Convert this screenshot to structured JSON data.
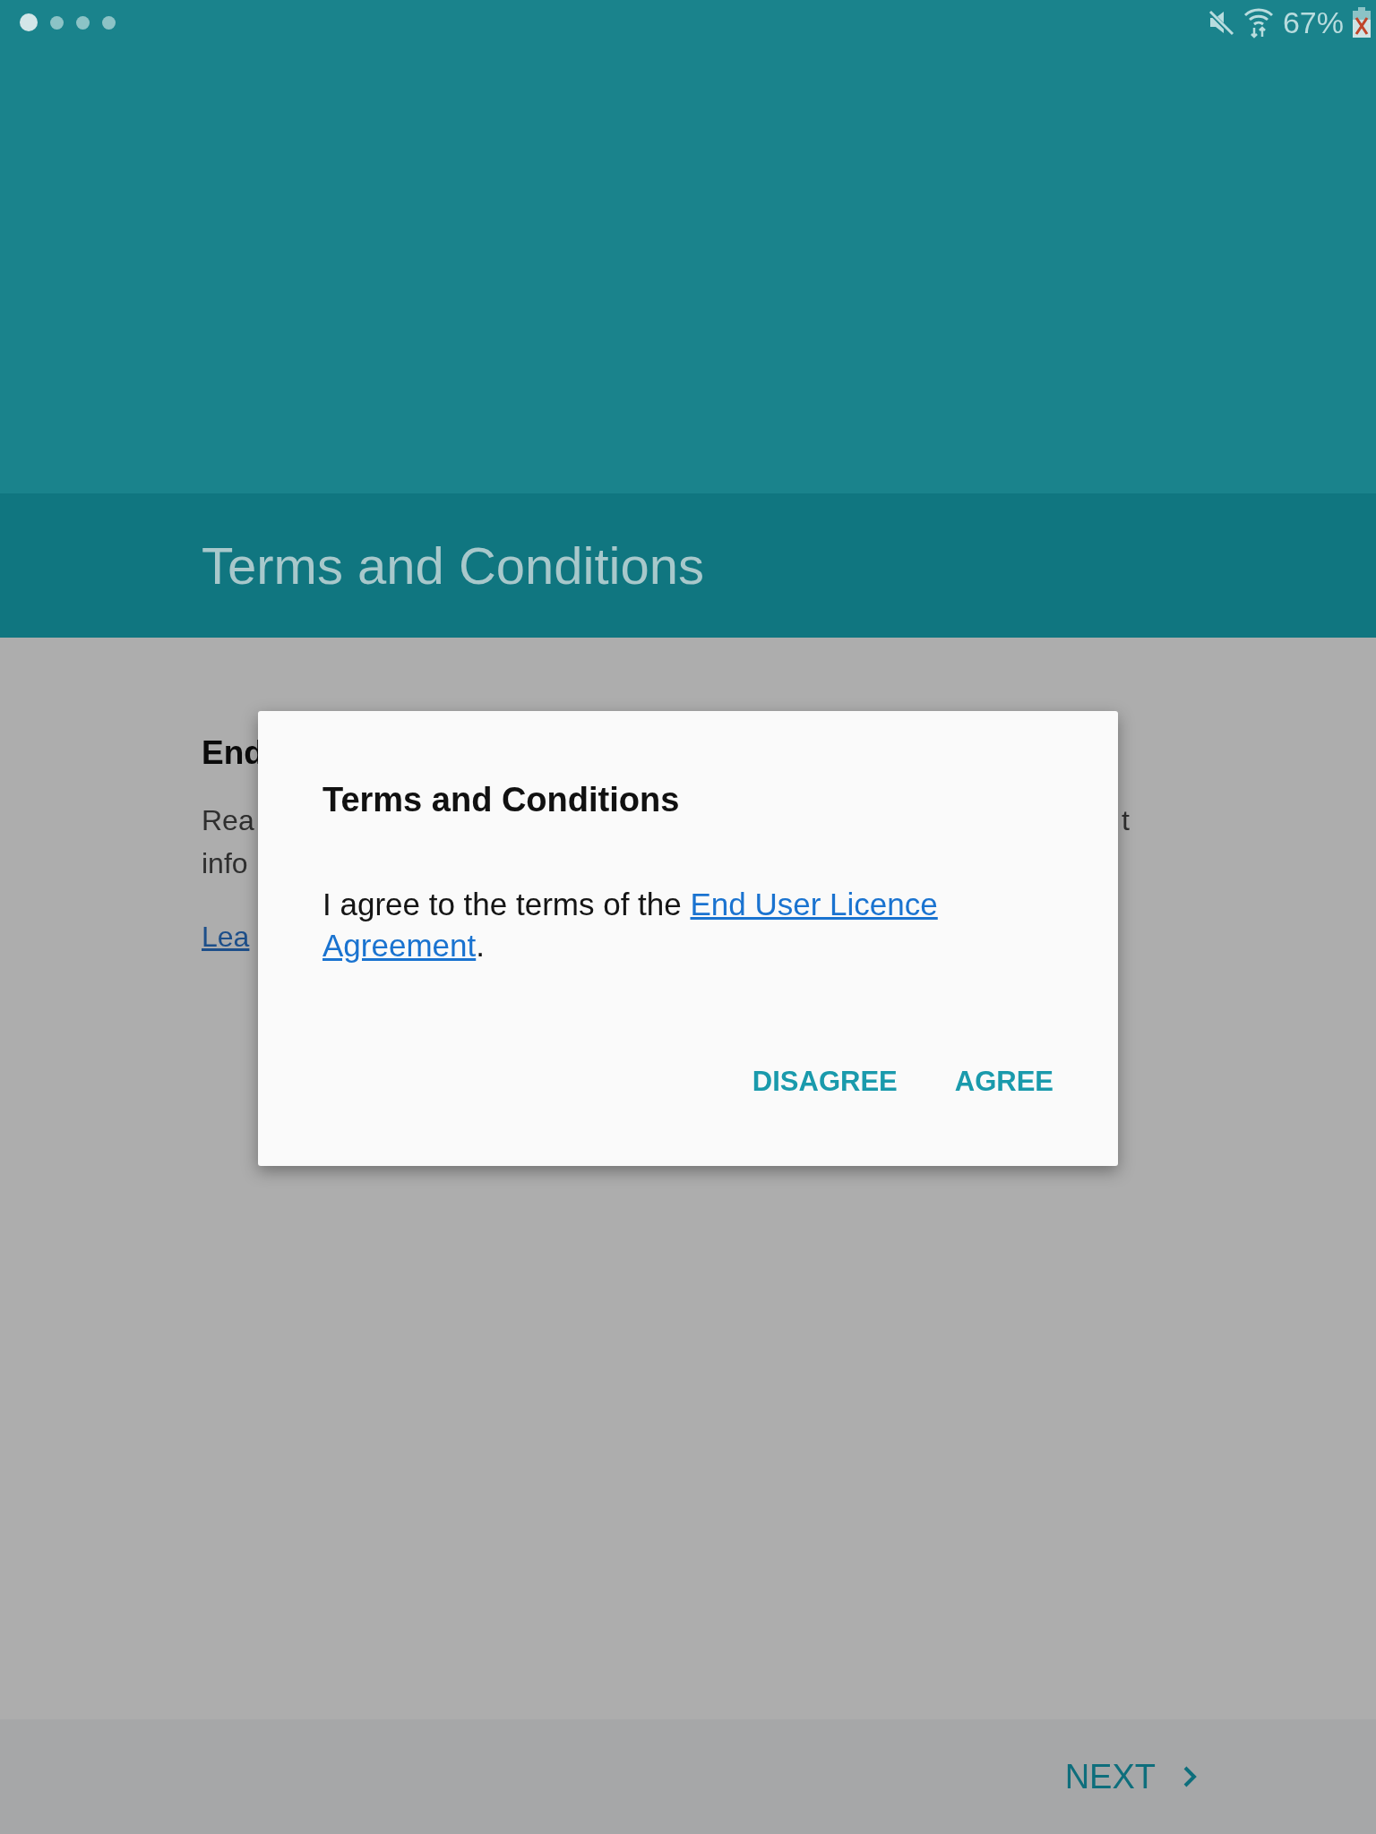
{
  "status_bar": {
    "battery": "67%"
  },
  "header": {
    "title": "Terms and Conditions"
  },
  "content": {
    "heading": "End",
    "paragraph_lines": [
      {
        "left": "Rea",
        "right": "t"
      },
      {
        "left": "info"
      }
    ],
    "link": "Lea"
  },
  "dialog": {
    "title": "Terms and Conditions",
    "text_before": "I agree to the terms of the ",
    "link_lines": [
      "End User Licence",
      "Agreement"
    ],
    "text_after": ".",
    "buttons": [
      {
        "label": "DISAGREE"
      },
      {
        "label": "AGREE"
      }
    ]
  },
  "footer": {
    "next": "NEXT"
  }
}
